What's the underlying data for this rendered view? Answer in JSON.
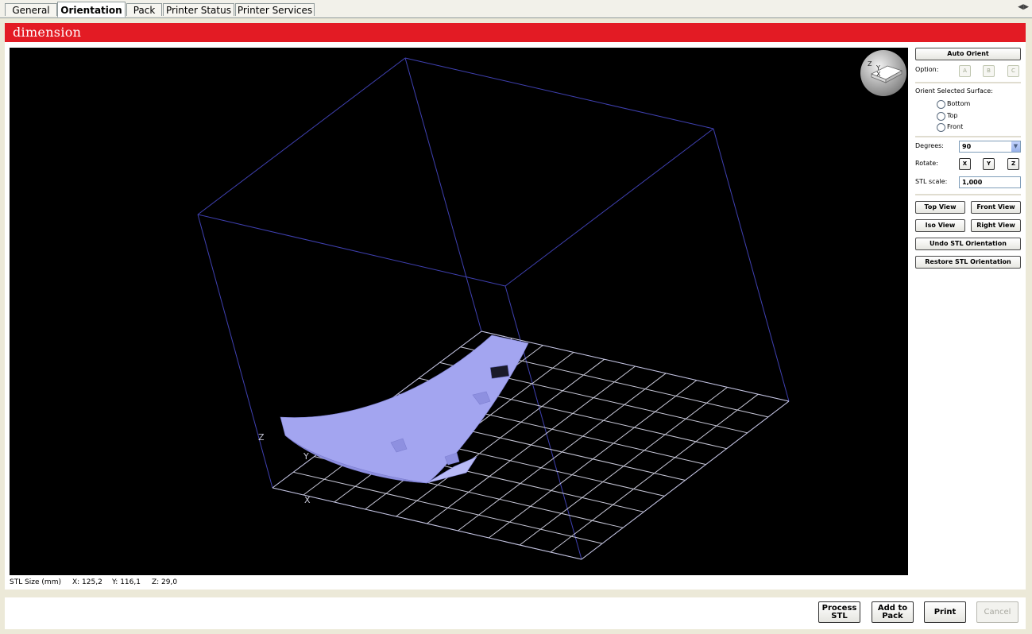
{
  "tabs": [
    "General",
    "Orientation",
    "Pack",
    "Printer Status",
    "Printer Services"
  ],
  "active_tab": "Orientation",
  "brand": {
    "logo_text": "dimension",
    "bar_color": "#e31b24"
  },
  "viewport": {
    "background": "#000000",
    "part_color": "#a3a5f0",
    "axis_labels": {
      "x": "X",
      "y": "Y",
      "z": "Z"
    },
    "orientation_cube_labels": {
      "z": "Z",
      "y": "Y",
      "x": "X"
    }
  },
  "status": {
    "size_label": "STL Size (mm)",
    "x": "X:  125,2",
    "y": "Y:  116,1",
    "z": "Z:  29,0"
  },
  "panel": {
    "auto_orient": "Auto Orient",
    "option_label": "Option:",
    "options": [
      "A",
      "B",
      "C"
    ],
    "orient_surface_label": "Orient Selected Surface:",
    "surfaces": [
      "Bottom",
      "Top",
      "Front"
    ],
    "degrees_label": "Degrees:",
    "degrees_value": "90",
    "rotate_label": "Rotate:",
    "rotate_axes": [
      "X",
      "Y",
      "Z"
    ],
    "stl_scale_label": "STL scale:",
    "stl_scale_value": "1,000",
    "top_view": "Top View",
    "front_view": "Front View",
    "iso_view": "Iso View",
    "right_view": "Right View",
    "undo": "Undo STL Orientation",
    "restore": "Restore STL Orientation"
  },
  "bottom_buttons": {
    "process_line1": "Process",
    "process_line2": "STL",
    "add_line1": "Add to",
    "add_line2": "Pack",
    "print": "Print",
    "cancel": "Cancel"
  }
}
